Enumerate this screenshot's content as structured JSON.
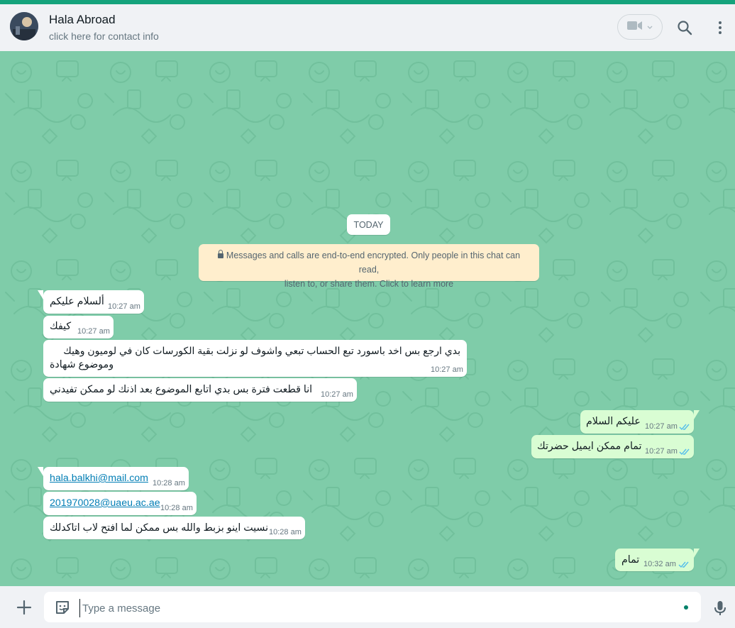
{
  "header": {
    "contact_name": "Hala Abroad",
    "contact_sub": "click here for contact info",
    "video_icon": "video-camera-icon",
    "search_icon": "search-icon",
    "menu_icon": "more-vertical-icon"
  },
  "chat": {
    "date_chip": "TODAY",
    "encryption_note_line1": "Messages and calls are end-to-end encrypted. Only people in this chat can read,",
    "encryption_note_line2": "listen to, or share them. Click to learn more",
    "messages": [
      {
        "dir": "in",
        "text": "ألسلام عليكم",
        "time": "10:27 am"
      },
      {
        "dir": "in",
        "text": "كيفك",
        "time": "10:27 am"
      },
      {
        "dir": "in",
        "text_line1": "بدي ارجع بس اخد باسورد تبع الحساب تبعي واشوف لو نزلت بقية الكورسات كان في لوميون وهيك",
        "text_line2": "وموضوع شهادة",
        "time": "10:27 am"
      },
      {
        "dir": "in",
        "text": "انا قطعت فترة بس بدي اتابع الموضوع بعد اذنك لو ممكن تفيدني",
        "time": "10:27 am"
      },
      {
        "dir": "out",
        "text": "عليكم السلام",
        "time": "10:27 am",
        "status": "read"
      },
      {
        "dir": "out",
        "text": "تمام ممكن ايميل حضرتك",
        "time": "10:27 am",
        "status": "read"
      },
      {
        "dir": "in",
        "text": "hala.balkhi@mail.com",
        "time": "10:28 am",
        "is_link": true
      },
      {
        "dir": "in",
        "text": "201970028@uaeu.ac.ae",
        "time": "10:28 am",
        "is_link": true
      },
      {
        "dir": "in",
        "text": "نسيت اينو بزبط والله بس ممكن لما افتح لاب اتاكدلك",
        "time": "10:28 am"
      },
      {
        "dir": "out",
        "text": "تمام",
        "time": "10:32 am",
        "status": "read"
      }
    ]
  },
  "footer": {
    "placeholder": "Type a message",
    "plus_icon": "plus-icon",
    "sticker_icon": "sticker-icon",
    "mic_icon": "microphone-icon"
  },
  "colors": {
    "chat_bg": "#7fcca9",
    "outgoing_bubble": "#d9fdd3",
    "incoming_bubble": "#ffffff",
    "read_tick": "#53bdeb",
    "top_accent": "#15a37c"
  }
}
